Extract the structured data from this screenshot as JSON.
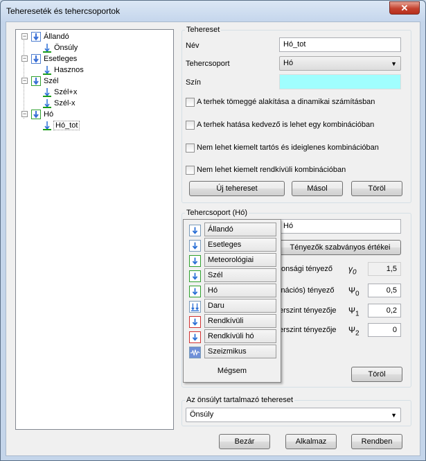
{
  "window": {
    "title": "Tehereseték és tehercsoportok",
    "close_glyph": "✕"
  },
  "tree": {
    "groups": [
      {
        "label": "Állandó",
        "children": [
          "Önsúly"
        ]
      },
      {
        "label": "Esetleges",
        "children": [
          "Hasznos"
        ]
      },
      {
        "label": "Szél",
        "children": [
          "Szél+x",
          "Szél-x"
        ]
      },
      {
        "label": "Hó",
        "children": [
          "Hó_tot"
        ]
      }
    ],
    "expander_glyph": "−"
  },
  "loadcase": {
    "group_title": "Tehereset",
    "name_label": "Név",
    "name_value": "Hó_tot",
    "group_label": "Tehercsoport",
    "group_value": "Hó",
    "color_label": "Szín",
    "color_value": "#a0fefe",
    "options": [
      "A terhek tömeggé alakítása a dinamikai számításban",
      "A terhek hatása kedvező is lehet egy kombinációban",
      "Nem lehet kiemelt tartós és ideiglenes kombinációban",
      "Nem lehet kiemelt rendkívüli kombinációban"
    ],
    "buttons": {
      "new": "Új tehereset",
      "copy": "Másol",
      "delete": "Töröl"
    }
  },
  "loadgroup": {
    "group_title": "Tehercsoport (Hó)",
    "name_value": "Hó",
    "std_factors_button": "Tényezők szabványos értékei",
    "factors": [
      {
        "label": "tonsági tényező",
        "symbol": "γ",
        "sub": "0",
        "value": "1,5",
        "readonly": true
      },
      {
        "label": "inációs) tényező",
        "symbol": "Ψ",
        "sub": "0",
        "value": "0,5",
        "readonly": false
      },
      {
        "label": "erszint tényezője",
        "symbol": "Ψ",
        "sub": "1",
        "value": "0,2",
        "readonly": false
      },
      {
        "label": "erszint tényezője",
        "symbol": "Ψ",
        "sub": "2",
        "value": "0",
        "readonly": false
      }
    ],
    "delete_button": "Töröl"
  },
  "popup": {
    "items": [
      {
        "label": "Állandó",
        "icon": "arrow-down-icon"
      },
      {
        "label": "Esetleges",
        "icon": "arrow-down-icon"
      },
      {
        "label": "Meteorológiai",
        "icon": "arrow-down-green-icon"
      },
      {
        "label": "Szél",
        "icon": "arrow-down-green-icon"
      },
      {
        "label": "Hó",
        "icon": "arrow-down-green-icon"
      },
      {
        "label": "Daru",
        "icon": "crane-load-icon"
      },
      {
        "label": "Rendkívüli",
        "icon": "arrow-down-red-icon"
      },
      {
        "label": "Rendkívüli hó",
        "icon": "arrow-down-red-icon"
      },
      {
        "label": "Szeizmikus",
        "icon": "seismic-icon"
      }
    ],
    "cancel": "Mégsem"
  },
  "selfweight": {
    "group_title": "Az önsúlyt tartalmazó tehereset",
    "value": "Önsúly"
  },
  "footer": {
    "close": "Bezár",
    "apply": "Alkalmaz",
    "ok": "Rendben"
  },
  "dropdown_glyph": "▼"
}
